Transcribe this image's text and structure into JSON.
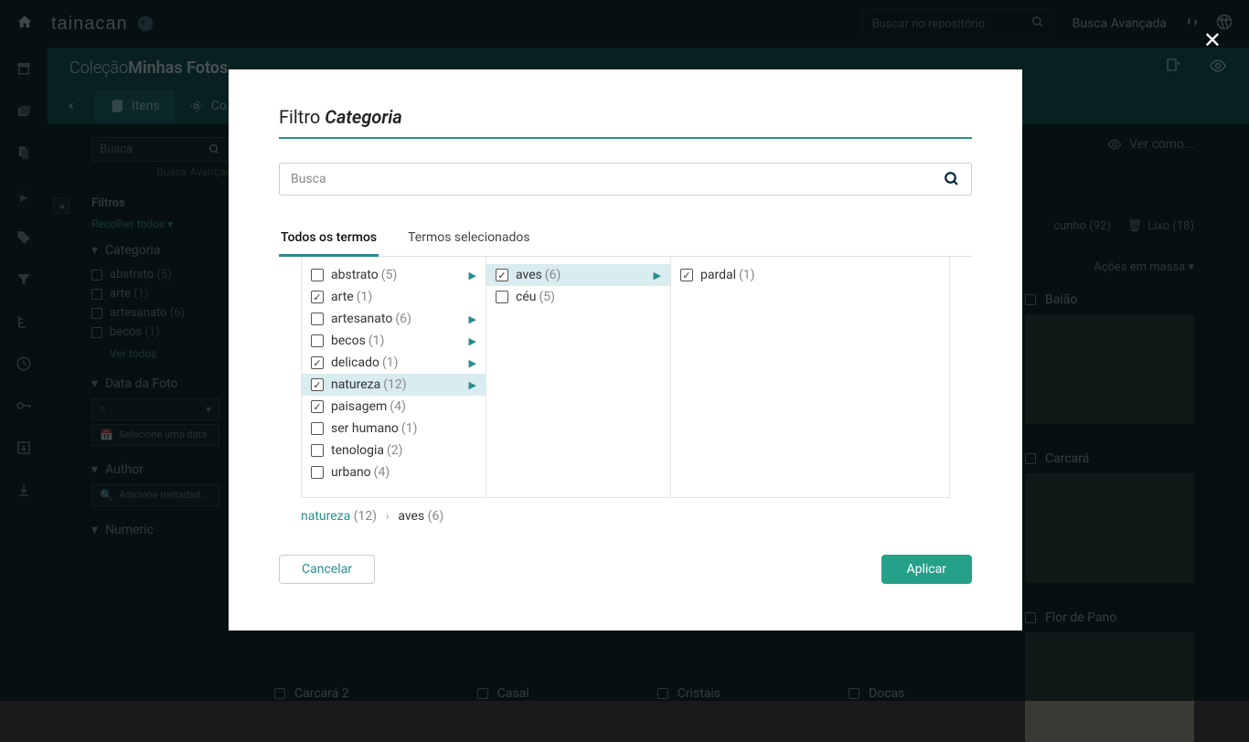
{
  "topbar": {
    "brand": "Tainacan",
    "search_placeholder": "Buscar no repositório",
    "advanced_search": "Busca Avançada"
  },
  "collection": {
    "prefix": "Coleção ",
    "name": "Minhas Fotos"
  },
  "tabs": {
    "items": "Itens",
    "config": "Co"
  },
  "filters_panel": {
    "search_placeholder": "Busca",
    "advanced_link": "Busca Avançada",
    "title": "Filtros",
    "collapse_all": "Recolher todos",
    "groups": {
      "categoria": {
        "title": "Categoria",
        "items": [
          {
            "label": "abstrato",
            "count": "(5)"
          },
          {
            "label": "arte",
            "count": "(1)"
          },
          {
            "label": "artesanato",
            "count": "(6)"
          },
          {
            "label": "becos",
            "count": "(1)"
          }
        ],
        "see_all": "Ver todos"
      },
      "data": {
        "title": "Data da Foto",
        "eq": "=",
        "placeholder": "Selecione uma data"
      },
      "author": {
        "title": "Author",
        "placeholder": "Adicione metadad…"
      },
      "numeric": {
        "title": "Numeric"
      }
    }
  },
  "content": {
    "view_as": "Ver como...",
    "status": {
      "draft": "cunho  (92)",
      "trash": "Lixo  (18)"
    },
    "mass_actions": "Ações em massa",
    "thumbs": [
      "Baião",
      "Carcará",
      "Flor de Pano"
    ],
    "bottom": [
      "Carcará 2",
      "Casal",
      "Cristais",
      "Docas"
    ]
  },
  "modal": {
    "title_prefix": "Filtro ",
    "title_category": "Categoria",
    "search_placeholder": "Busca",
    "tab_all": "Todos os termos",
    "tab_selected": "Termos selecionados",
    "col1": [
      {
        "label": "abstrato",
        "count": "(5)",
        "checked": false,
        "chevron": true
      },
      {
        "label": "arte",
        "count": "(1)",
        "checked": true,
        "chevron": false
      },
      {
        "label": "artesanato",
        "count": "(6)",
        "checked": false,
        "chevron": true
      },
      {
        "label": "becos",
        "count": "(1)",
        "checked": false,
        "chevron": true
      },
      {
        "label": "delicado",
        "count": "(1)",
        "checked": true,
        "chevron": true
      },
      {
        "label": "natureza",
        "count": "(12)",
        "checked": true,
        "chevron": true,
        "selected": true
      },
      {
        "label": "paisagem",
        "count": "(4)",
        "checked": true,
        "chevron": false
      },
      {
        "label": "ser humano",
        "count": "(1)",
        "checked": false,
        "chevron": false
      },
      {
        "label": "tenologia",
        "count": "(2)",
        "checked": false,
        "chevron": false
      },
      {
        "label": "urbano",
        "count": "(4)",
        "checked": false,
        "chevron": false
      }
    ],
    "col2": [
      {
        "label": "aves",
        "count": "(6)",
        "checked": true,
        "chevron": true,
        "selected": true
      },
      {
        "label": "céu",
        "count": "(5)",
        "checked": false,
        "chevron": false
      }
    ],
    "col3": [
      {
        "label": "pardal",
        "count": "(1)",
        "checked": true,
        "chevron": false
      }
    ],
    "breadcrumb": {
      "p1": "natureza",
      "c1": "(12)",
      "p2": "aves",
      "c2": "(6)"
    },
    "cancel": "Cancelar",
    "apply": "Aplicar"
  }
}
